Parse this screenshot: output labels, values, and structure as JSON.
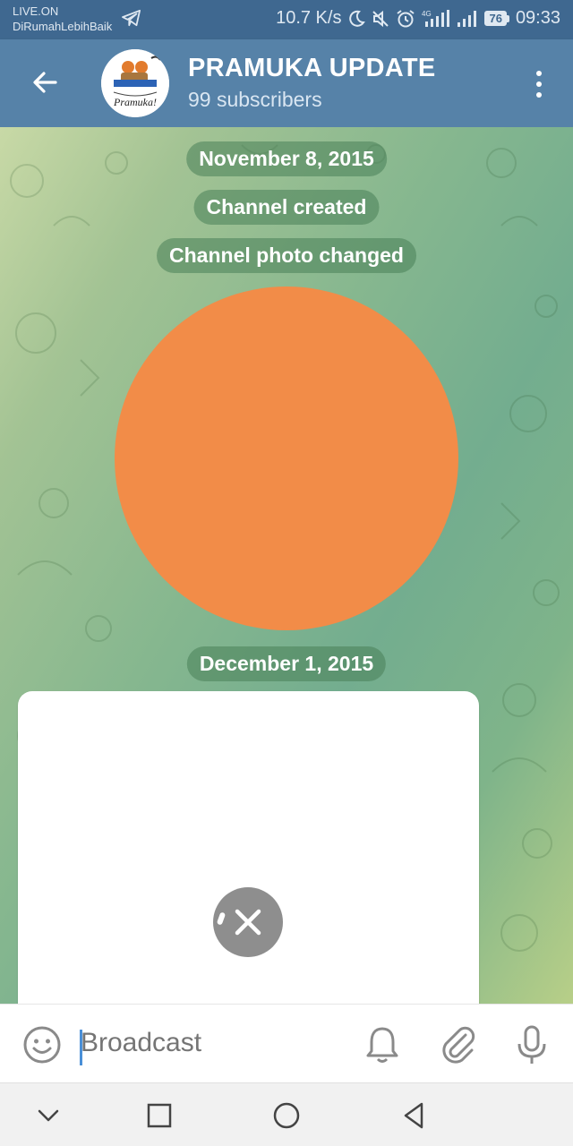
{
  "status_bar": {
    "left_line1": "LIVE.ON",
    "left_line2": "DiRumahLebihBaik",
    "speed": "10.7 K/s",
    "network": "4G",
    "battery": "76",
    "time": "09:33"
  },
  "header": {
    "title": "PRAMUKA UPDATE",
    "subtitle": "99 subscribers",
    "avatar_text": "Pramuka!"
  },
  "chat": {
    "date1": "November 8, 2015",
    "service1": "Channel created",
    "service2": "Channel photo changed",
    "date2": "December 1, 2015",
    "photo_color": "#f28c48"
  },
  "input": {
    "placeholder": "Broadcast"
  },
  "colors": {
    "header_bg": "#5682a8",
    "status_bg": "#3f6890",
    "accent": "#4a8fd8"
  }
}
